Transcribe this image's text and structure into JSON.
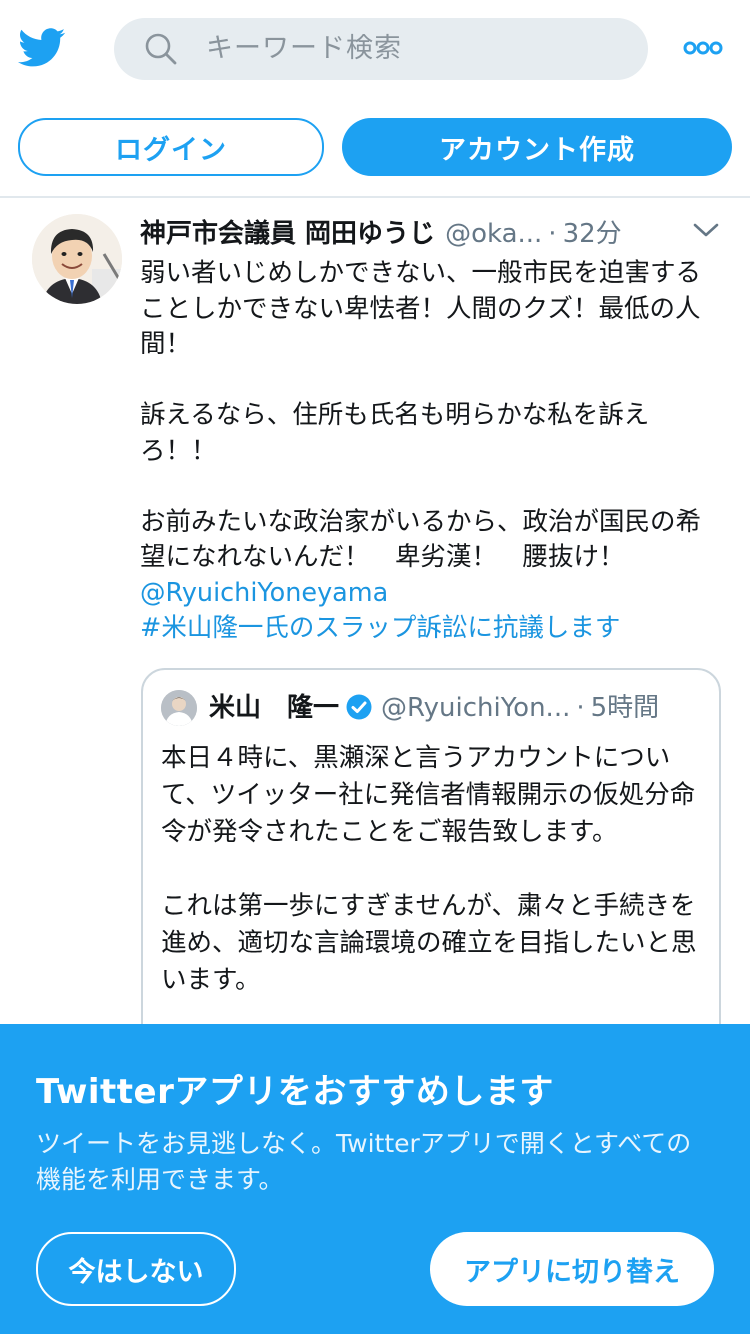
{
  "header": {
    "search_placeholder": "キーワード検索"
  },
  "auth": {
    "login_label": "ログイン",
    "signup_label": "アカウント作成"
  },
  "tweet": {
    "author_name": "神戸市会議員 岡田ゆうじ",
    "author_handle": "@oka...",
    "time": "32分",
    "text_lines": [
      "弱い者いじめしかできない、一般市民を迫害することしかできない卑怯者！人間のクズ！最低の人間！",
      "",
      "訴えるなら、住所も氏名も明らかな私を訴えろ！！",
      "",
      "お前みたいな政治家がいるから、政治が国民の希望になれないんだ！　卑劣漢！　腰抜け！"
    ],
    "mention": "@RyuichiYoneyama",
    "hashtag": "#米山隆一氏のスラップ訴訟に抗議します"
  },
  "quote": {
    "author_name": "米山　隆一",
    "author_handle": "@RyuichiYon...",
    "time": "5時間",
    "text": "本日４時に、黒瀬深と言うアカウントについて、ツイッター社に発信者情報開示の仮処分命令が発令されたことをご報告致します。\n\nこれは第一歩にすぎませんが、粛々と手続きを進め、適切な言論環境の確立を目指したいと思います。"
  },
  "banner": {
    "title": "Twitterアプリをおすすめします",
    "description": "ツイートをお見逃しなく。Twitterアプリで開くとすべての機能を利用できます。",
    "not_now_label": "今はしない",
    "switch_label": "アプリに切り替え"
  },
  "colors": {
    "brand": "#1da1f2",
    "link": "#1b95e0",
    "muted": "#657786"
  }
}
